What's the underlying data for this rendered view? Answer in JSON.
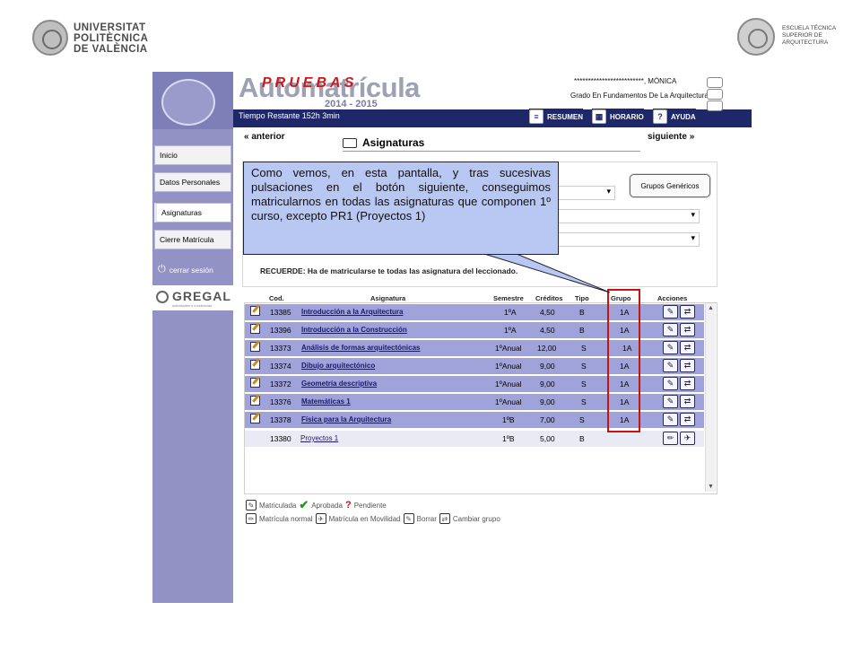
{
  "logos": {
    "left_lines": [
      "UNIVERSITAT",
      "POLITÈCNICA",
      "DE VALÈNCIA"
    ],
    "right_lines": [
      "ESCUELA TÉCNICA",
      "SUPERIOR DE",
      "ARQUITECTURA"
    ]
  },
  "header": {
    "app_title": "Automatrícula",
    "watermark": "PRUEBAS",
    "year": "2014 - 2015",
    "time_left": "Tiempo Restante 152h 3min",
    "user_name": "*************************, MÓNICA",
    "degree": "Grado En Fundamentos De La Arquitectura",
    "buttons": {
      "resumen": "RESUMEN",
      "horario": "HORARIO",
      "ayuda": "AYUDA"
    }
  },
  "sidebar": {
    "items": [
      "Inicio",
      "Datos Personales",
      "Asignaturas",
      "Cierre Matrícula"
    ],
    "active_index": 2,
    "logout": "cerrar sesión",
    "gregal": "GREGAL",
    "gregal_sub": "actividades e incidencias"
  },
  "content": {
    "prev": "anterior",
    "next": "siguiente",
    "section_title": "Asignaturas",
    "grupos_button": "Grupos Genéricos",
    "recuerde": "RECUERDE: Ha de matricularse te todas las asignatura del                    leccionado."
  },
  "table": {
    "headers": [
      "Cod.",
      "Asignatura",
      "Semestre",
      "Créditos",
      "Tipo",
      "Grupo",
      "Acciones"
    ],
    "rows": [
      {
        "cod": "13385",
        "name": "Introducción a la Arquitectura",
        "sem": "1ºA",
        "cred": "4,50",
        "tipo": "B",
        "grupo": "1A"
      },
      {
        "cod": "13396",
        "name": "Introducción a la Construcción",
        "sem": "1ºA",
        "cred": "4,50",
        "tipo": "B",
        "grupo": "1A"
      },
      {
        "cod": "13373",
        "name": "Análisis de formas arquitectónicas",
        "sem": "1ºAnual",
        "cred": "12,00",
        "tipo": "S",
        "grupo": "1A"
      },
      {
        "cod": "13374",
        "name": "Dibujo arquitectónico",
        "sem": "1ºAnual",
        "cred": "9,00",
        "tipo": "S",
        "grupo": "1A"
      },
      {
        "cod": "13372",
        "name": "Geometría descriptiva",
        "sem": "1ºAnual",
        "cred": "9,00",
        "tipo": "S",
        "grupo": "1A"
      },
      {
        "cod": "13376",
        "name": "Matemáticas 1",
        "sem": "1ºAnual",
        "cred": "9,00",
        "tipo": "S",
        "grupo": "1A"
      },
      {
        "cod": "13378",
        "name": "Física para la Arquitectura",
        "sem": "1ºB",
        "cred": "7,00",
        "tipo": "S",
        "grupo": "1A"
      },
      {
        "cod": "13380",
        "name": "Proyectos 1",
        "sem": "1ºB",
        "cred": "5,00",
        "tipo": "B",
        "grupo": ""
      }
    ]
  },
  "legend": {
    "matriculada": "Matriculada",
    "aprobada": "Aprobada",
    "pendiente": "Pendiente",
    "matricula_normal": "Matrícula normal",
    "matricula_movilidad": "Matrícula en Movilidad",
    "borrar": "Borrar",
    "cambiar_grupo": "Cambiar grupo"
  },
  "callout": {
    "text": "Como vemos, en esta pantalla, y tras sucesivas pulsaciones en el botón siguiente, conseguimos matricularnos en todas las asignaturas que componen 1º curso, excepto PR1 (Proyectos 1)"
  },
  "colors": {
    "sidebar": "#9392c4",
    "header_band": "#1e2868",
    "row_enrolled": "#9fa3da",
    "row_pending": "#eaeaf4",
    "highlight": "#cc1111",
    "callout_bg": "#b9c7f3"
  }
}
